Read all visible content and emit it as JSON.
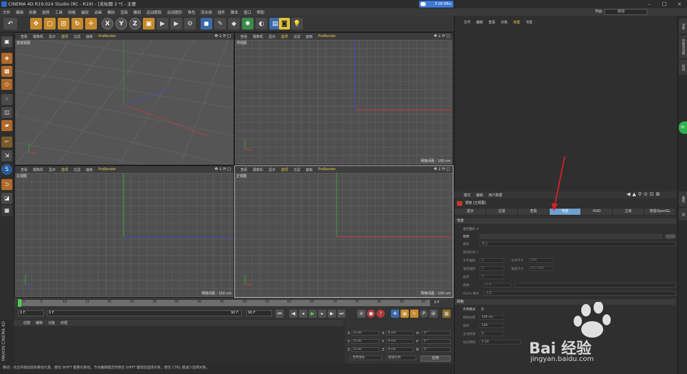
{
  "title_bar": {
    "title": "CINEMA 4D R19.024 Studio (RC - R19) - [未标题 2 *] - 主要",
    "net_speed": "0.06 KB/s"
  },
  "menu": [
    "文件",
    "编辑",
    "创建",
    "选择",
    "工具",
    "网格",
    "捕捉",
    "动画",
    "模拟",
    "渲染",
    "雕刻",
    "运动跟踪",
    "运动图形",
    "角色",
    "流水线",
    "插件",
    "脚本",
    "窗口",
    "帮助"
  ],
  "layout": {
    "label": "界面:",
    "value": "启动"
  },
  "viewports": [
    {
      "menu": [
        "查看",
        "摄像机",
        "显示",
        "选项",
        "过滤",
        "面板",
        "ProRender"
      ],
      "title": "透视视图",
      "footer": ""
    },
    {
      "menu": [
        "查看",
        "摄像机",
        "显示",
        "选项",
        "过滤",
        "面板",
        "ProRender"
      ],
      "title": "顶视图",
      "footer": "网格间距 : 100 cm"
    },
    {
      "menu": [
        "查看",
        "摄像机",
        "显示",
        "选项",
        "过滤",
        "面板",
        "ProRender"
      ],
      "title": "右视图",
      "footer": "网格间距 : 100 cm"
    },
    {
      "menu": [
        "查看",
        "摄像机",
        "显示",
        "选项",
        "过滤",
        "面板",
        "ProRender"
      ],
      "title": "正视图",
      "footer": "网格间距 : 100 cm"
    }
  ],
  "timeline": {
    "ticks": [
      "0",
      "5",
      "10",
      "15",
      "20",
      "25",
      "30",
      "35",
      "40",
      "45",
      "50",
      "55",
      "60",
      "65",
      "70",
      "75",
      "80",
      "85",
      "90"
    ],
    "end_frame": "0 F",
    "start": "0 F",
    "start2": "0 F",
    "max": "90 F",
    "max2": "90 F"
  },
  "material_tabs": [
    "创建",
    "编辑",
    "功能",
    "纹理"
  ],
  "maxon": "MAXON CINEMA 4D",
  "coords": {
    "rows": [
      {
        "a": "X",
        "av": "0 cm",
        "b": "X",
        "bv": "0 cm",
        "c": "H",
        "cv": "0 °"
      },
      {
        "a": "Y",
        "av": "0 cm",
        "b": "Y",
        "bv": "0 cm",
        "c": "P",
        "cv": "0 °"
      },
      {
        "a": "Z",
        "av": "0 cm",
        "b": "Z",
        "bv": "0 cm",
        "c": "B",
        "cv": "0 °"
      }
    ],
    "mode1": "世界坐标",
    "mode2": "缩放比例",
    "apply": "应用"
  },
  "status": "移动：点击并拖动鼠标移动元素。按住 SHIFT 键量化移动；节点编辑模式时按住 SHIFT 键增加选择对象；按住 CTRL 键减少选择对象。",
  "object_manager": {
    "menu": [
      "文件",
      "编辑",
      "查看",
      "对象",
      "标签",
      "书签"
    ]
  },
  "attr_manager": {
    "menu": [
      "模式",
      "编辑",
      "用户数据"
    ],
    "title": "视窗 [正视图]",
    "tabs": [
      "显示",
      "过滤",
      "查看",
      "背景",
      "HUD",
      "立体",
      "增强OpenGL"
    ],
    "active_tab": "背景",
    "section_bg": "背景",
    "section_grid": "网格",
    "props": {
      "show_image": "显示图片 ✔",
      "image": "图像",
      "mode": "模式",
      "mode_val": "独占",
      "keep_ratio": "保持比例 ✔",
      "h_offset": "水平偏移",
      "h_offset_v": "0",
      "h_size": "水平尺寸",
      "h_size_v": "800",
      "v_offset": "垂直偏移",
      "v_offset_v": "0",
      "v_size": "垂直尺寸",
      "v_size_v": "611.995",
      "rotate": "旋转",
      "rotate_v": "0 °",
      "transparency": "透明",
      "transparency_v": "0 %",
      "alpha": "Alpha 模式",
      "alpha_v": "正常",
      "work_mode": "作用模式",
      "work_mode_v": "点",
      "grid_spacing": "网格间距",
      "grid_spacing_v": "100 cm",
      "lines": "线条",
      "lines_v": "100",
      "major": "主线周期",
      "major_v": "5",
      "dynamic": "动态网格",
      "dynamic_v": "1:10"
    }
  },
  "right_tabs": [
    "对象",
    "内容浏览器",
    "构造",
    "属性",
    "层"
  ],
  "green_badge": "91",
  "watermark": {
    "brand": "Bai 经验",
    "url": "jingyan.baidu.com"
  }
}
